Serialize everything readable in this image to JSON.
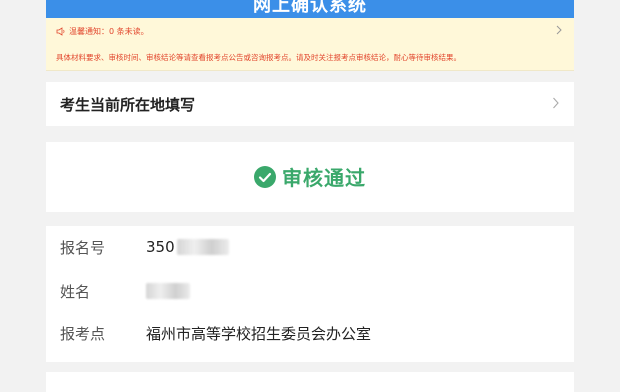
{
  "header": {
    "title": "网上确认系统"
  },
  "notice": {
    "line1": "温馨通知：0 条未读。",
    "line2": "具体材料要求、审核时间、审核结论等请查看报考点公告或咨询报考点。请及时关注报考点审核结论，耐心等待审核结果。",
    "colors": {
      "text": "#e2462d",
      "background": "#fff8d9"
    }
  },
  "location": {
    "label": "考生当前所在地填写"
  },
  "status": {
    "text": "审核通过",
    "color": "#3aa86b",
    "icon": "check-circle-icon"
  },
  "info": {
    "rows": [
      {
        "label": "报名号",
        "value": "350"
      },
      {
        "label": "姓名",
        "value": ""
      },
      {
        "label": "报考点",
        "value": "福州市高等学校招生委员会办公室"
      }
    ]
  },
  "colors": {
    "primary": "#3b8fe8",
    "page_bg": "#f2f2f2"
  }
}
